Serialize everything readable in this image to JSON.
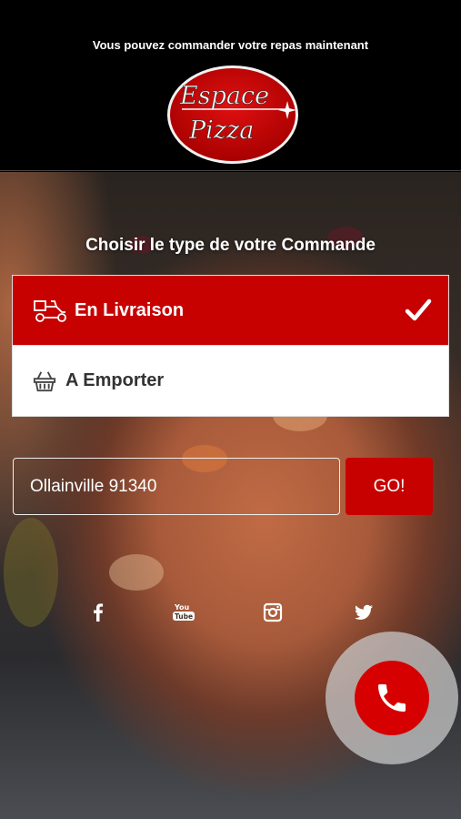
{
  "header": {
    "tagline": "Vous pouvez commander votre repas maintenant",
    "logo_line1": "Espace",
    "logo_line2": "Pizza"
  },
  "main": {
    "title": "Choisir le type de votre Commande",
    "options": [
      {
        "label": "En Livraison",
        "icon": "scooter-icon",
        "selected": true
      },
      {
        "label": "A Emporter",
        "icon": "basket-icon",
        "selected": false
      }
    ],
    "address": {
      "value": "Ollainville 91340",
      "placeholder": ""
    },
    "go_label": "GO!"
  },
  "socials": [
    "facebook-icon",
    "youtube-icon",
    "instagram-icon",
    "twitter-icon"
  ],
  "call_button": {
    "icon": "phone-icon"
  },
  "colors": {
    "accent": "#c70000",
    "header_bg": "#000000",
    "text_light": "#ffffff"
  }
}
